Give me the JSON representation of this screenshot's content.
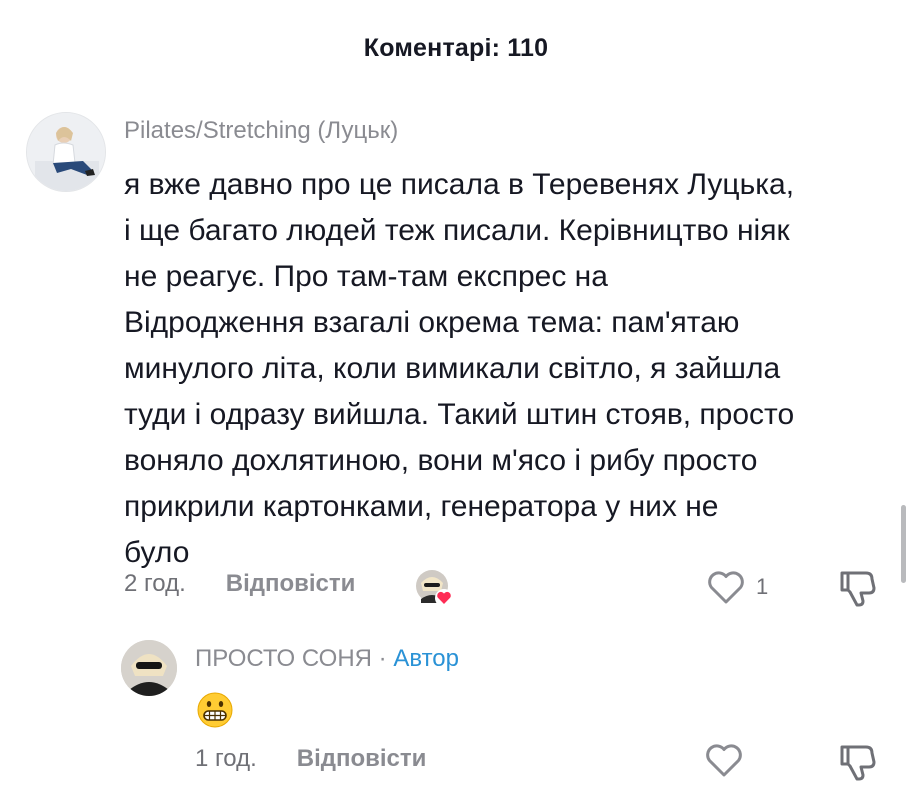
{
  "header": {
    "title": "Коментарі: 110"
  },
  "comment": {
    "username": "Pilates/Stretching (Луцьк)",
    "text_lines": [
      "я вже давно про це писала в Теревенях Луцька,",
      "і ще багато людей теж писали. Керівництво ніяк",
      "не реагує. Про там-там експрес на",
      "Відродження взагалі окрема тема: пам'ятаю",
      "минулого літа, коли вимикали світло, я зайшла",
      "туди і одразу вийшла. Такий штин стояв, просто",
      "воняло дохлятиною, вони м'ясо і рибу просто",
      "прикрили картонками, генератора у них не",
      "було"
    ],
    "time": "2 год.",
    "reply_label": "Відповісти",
    "like_count": "1"
  },
  "reply": {
    "username": "ПРОСТО СОНЯ",
    "separator": "·",
    "author_tag": "Автор",
    "emoji": "grimacing-face",
    "time": "1 год.",
    "reply_label": "Відповісти"
  },
  "colors": {
    "text": "#161823",
    "muted": "#8a8b91",
    "author": "#2a92d6",
    "heart": "#fe2c55"
  }
}
